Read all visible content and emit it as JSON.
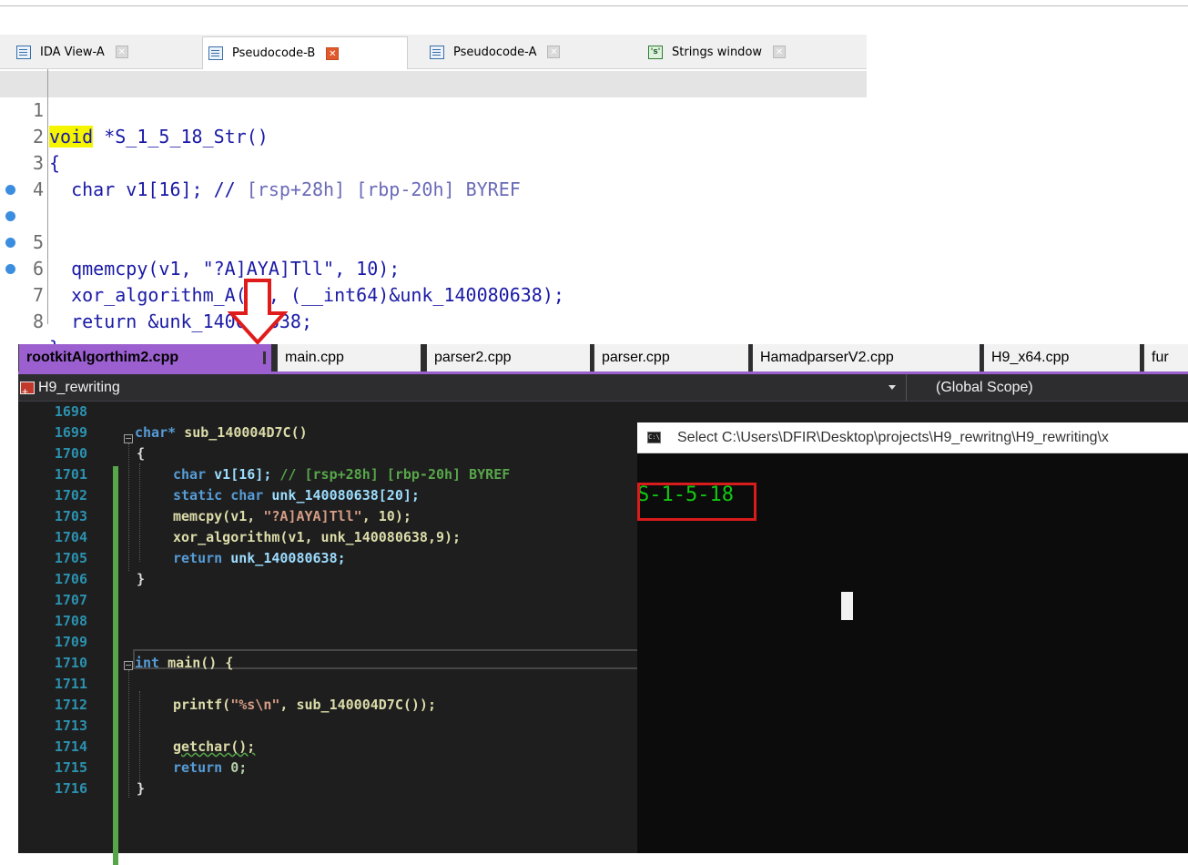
{
  "ida": {
    "tabs": [
      {
        "label": "IDA View-A",
        "icon": "listing-icon",
        "active": false
      },
      {
        "label": "Pseudocode-B",
        "icon": "pseudocode-icon",
        "active": true
      },
      {
        "label": "Pseudocode-A",
        "icon": "pseudocode-icon",
        "active": false
      },
      {
        "label": "Strings window",
        "icon": "strings-icon",
        "active": false
      }
    ],
    "lines": [
      {
        "num": "1",
        "code": "*S_1_5_18_Str()",
        "keyword": "void"
      },
      {
        "num": "2",
        "code": "{"
      },
      {
        "num": "3",
        "code": "  char v1[16]; // ",
        "comment": "[rsp+28h] [rbp-20h] BYREF"
      },
      {
        "num": "4",
        "code": ""
      },
      {
        "num": "5",
        "code": "  qmemcpy(v1, \"?A]AYA]Tll\", 10);"
      },
      {
        "num": "6",
        "code": "  xor_algorithm_A(v1, (__int64)&unk_140080638);"
      },
      {
        "num": "7",
        "code": "  return &unk_140080638;"
      },
      {
        "num": "8",
        "code": "}"
      }
    ]
  },
  "vs": {
    "tabs": [
      "rootkitAlgorthim2.cpp",
      "main.cpp",
      "parser2.cpp",
      "parser.cpp",
      "HamadparserV2.cpp",
      "H9_x64.cpp",
      "fur"
    ],
    "project": "H9_rewriting",
    "scope": "(Global Scope)",
    "line_numbers": [
      "1698",
      "1699",
      "1700",
      "1701",
      "1702",
      "1703",
      "1704",
      "1705",
      "1706",
      "1707",
      "1708",
      "1709",
      "1710",
      "1711",
      "1712",
      "1713",
      "1714",
      "1715",
      "1716"
    ],
    "code": {
      "l1699_kw": "char*",
      "l1699_fn": "sub_140004D7C()",
      "l1700": "{",
      "l1701_kw": "char",
      "l1701_rest": "v1[16];",
      "l1701_cm": "// [rsp+28h] [rbp-20h] BYREF",
      "l1702_kw": "static char",
      "l1702_rest": "unk_140080638[20];",
      "l1703_fn": "memcpy(v1, ",
      "l1703_str": "\"?A]AYA]Tll\"",
      "l1703_rest": ", 10);",
      "l1704": "xor_algorithm(v1, unk_140080638,9);",
      "l1705_kw": "return",
      "l1705_rest": "unk_140080638;",
      "l1706": "}",
      "l1710_kw": "int",
      "l1710_rest": "main() {",
      "l1712_fn": "printf(",
      "l1712_str": "\"%s\\n\"",
      "l1712_rest": ", sub_140004D7C());",
      "l1714": "getchar();",
      "l1715_kw": "return",
      "l1715_rest": "0;",
      "l1716": "}"
    }
  },
  "console": {
    "title": "Select C:\\Users\\DFIR\\Desktop\\projects\\H9_rewritng\\H9_rewriting\\x",
    "output": "S-1-5-18"
  },
  "colors": {
    "vs_accent": "#9b5fcf",
    "console_text": "#13c913",
    "highlight_box": "#d81b1b",
    "arrow": "#e01b1b"
  }
}
